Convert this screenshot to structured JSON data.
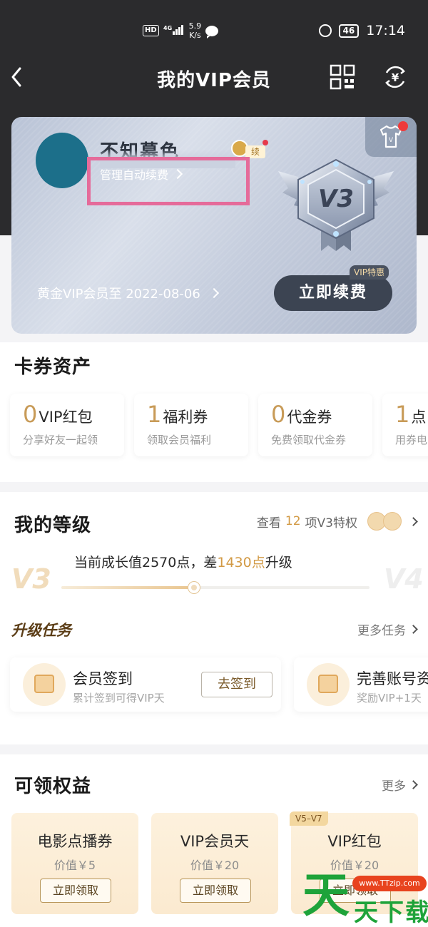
{
  "status_bar": {
    "network": "HD",
    "signal": "4G",
    "speed_value": "5.9",
    "speed_unit": "K/s",
    "battery": "46",
    "time": "17:14"
  },
  "nav": {
    "title": "我的VIP会员"
  },
  "vip_card": {
    "username": "不知幕色",
    "manage_label": "管理自动续费",
    "renew_tag": "续",
    "badge_label": "V3",
    "expire_text": "黄金VIP会员至 2022-08-06",
    "deal_tag": "VIP特惠",
    "renew_button": "立即续费"
  },
  "assets": {
    "title": "卡券资产",
    "items": [
      {
        "num": "0",
        "name": "VIP红包",
        "desc": "分享好友一起领"
      },
      {
        "num": "1",
        "name": "福利券",
        "desc": "领取会员福利"
      },
      {
        "num": "0",
        "name": "代金券",
        "desc": "免费领取代金券"
      },
      {
        "num": "1",
        "name": "点",
        "desc": "用券电"
      }
    ]
  },
  "level": {
    "title": "我的等级",
    "link_prefix": "查看",
    "link_count": "12",
    "link_suffix": "项V3特权",
    "progress_prefix": "当前成长值2570点，差",
    "progress_diff": "1430点",
    "progress_suffix": "升级",
    "current_level": "V3",
    "next_level": "V4",
    "progress_fraction": 0.43
  },
  "tasks": {
    "title": "升级任务",
    "more_label": "更多任务",
    "items": [
      {
        "name": "会员签到",
        "desc": "累计签到可得VIP天",
        "button": "去签到"
      },
      {
        "name": "完善账号资",
        "desc": "奖励VIP+1天"
      }
    ]
  },
  "benefits": {
    "title": "可领权益",
    "more_label": "更多",
    "items": [
      {
        "name": "电影点播券",
        "value": "价值￥5",
        "button": "立即领取",
        "tier": ""
      },
      {
        "name": "VIP会员天",
        "value": "价值￥20",
        "button": "立即领取",
        "tier": ""
      },
      {
        "name": "VIP红包",
        "value": "价值￥20",
        "button": "立即领取",
        "tier": "V5–V7"
      }
    ]
  },
  "watermark": {
    "url": "www.TTzip.com",
    "big_char": "天",
    "text": "天下载"
  }
}
